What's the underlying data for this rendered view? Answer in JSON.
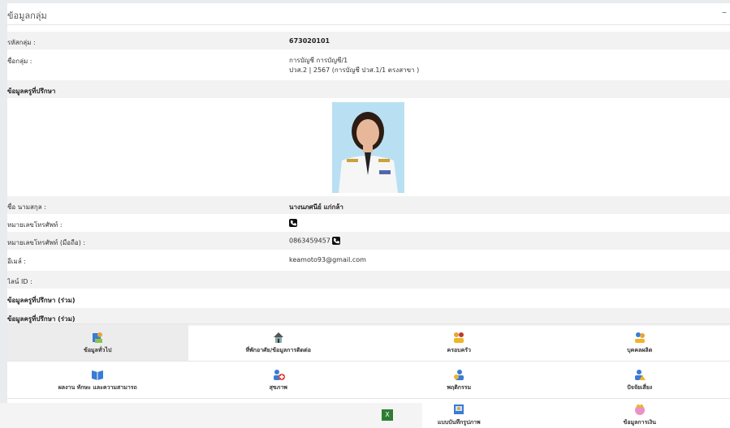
{
  "header": {
    "title": "ข้อมูลกลุ่ม",
    "collapse_symbol": "–"
  },
  "group": {
    "code_label": "รหัสกลุ่ม :",
    "code_value": "673020101",
    "name_label": "ชื่อกลุ่ม :",
    "name_line1": "การบัญชี การบัญชี/1",
    "name_line2": "ปวส.2 | 2567 (การบัญชี ปวส.1/1 ตรงสาขา )"
  },
  "advisor": {
    "section_title": "ข้อมูลครูที่ปรึกษา",
    "name_label": "ชื่อ นามสกุล :",
    "name_value": "นางนภศนีย์ แก่กล้า",
    "phone_label": "หมายเลขโทรศัพท์ :",
    "mobile_label": "หมายเลขโทรศัพท์ (มือถือ) :",
    "mobile_value": "0863459457",
    "email_label": "อีเมล์ :",
    "email_value": "keamoto93@gmail.com",
    "line_label": "ไลน์ ID :",
    "joint1": "ข้อมูลครูที่ปรึกษา (ร่วม)",
    "joint2": "ข้อมูลครูที่ปรึกษา (ร่วม)"
  },
  "menu": {
    "row1": [
      "ข้อมูลทั่วไป",
      "ที่พักอาศัย/ข้อมูลการติดต่อ",
      "ครอบครัว",
      "บุคคลผลิต"
    ],
    "row2": [
      "ผลงาน ทักษะ และความสามารถ",
      "สุขภาพ",
      "พฤติกรรม",
      "ปัจจัยเสี่ยง"
    ],
    "row3": [
      "แบบบันทึกรูปภาพ",
      "ข้อมูลการเงิน"
    ]
  },
  "colors": {
    "accent": "#3a7bd5",
    "alt_row": "#f2f2f2"
  }
}
